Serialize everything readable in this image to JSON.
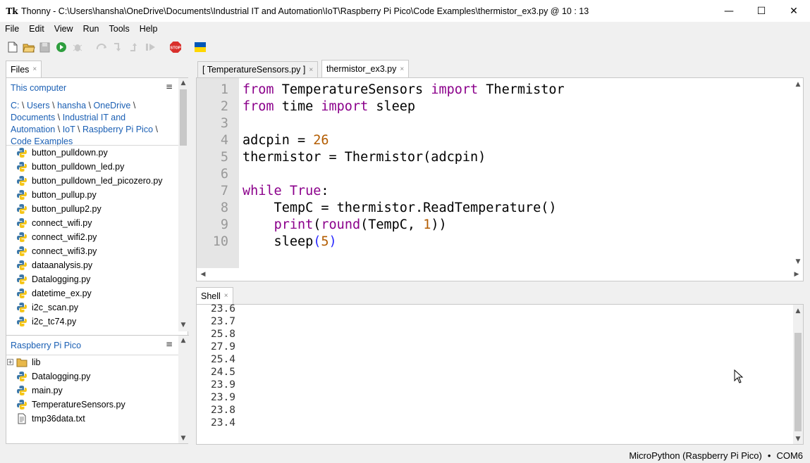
{
  "window": {
    "app_icon": "Tk",
    "title": "Thonny  -  C:\\Users\\hansha\\OneDrive\\Documents\\Industrial IT and Automation\\IoT\\Raspberry Pi Pico\\Code Examples\\thermistor_ex3.py  @  10 : 13",
    "minimize": "—",
    "maximize": "☐",
    "close": "✕"
  },
  "menu": [
    "File",
    "Edit",
    "View",
    "Run",
    "Tools",
    "Help"
  ],
  "toolbar": {
    "buttons": [
      "new-file",
      "open-file",
      "save-file",
      "run",
      "debug",
      "step-over",
      "step-into",
      "step-out",
      "resume",
      "stop",
      "ukraine-flag"
    ],
    "stop_label": "STOP",
    "colors": {
      "run": "#2e9e3e",
      "stop": "#d9302c",
      "flag_blue": "#0057b7",
      "flag_yellow": "#ffd700"
    }
  },
  "files_tab": {
    "label": "Files",
    "close": "×"
  },
  "computer": {
    "title": "This computer",
    "menu_icon": "≡",
    "breadcrumb": [
      "C:",
      "Users",
      "hansha",
      "OneDrive",
      "Documents",
      "Industrial IT and Automation",
      "IoT",
      "Raspberry Pi Pico",
      "Code Examples"
    ],
    "breadcrumb_sep": "\\",
    "files": [
      "button_pulldown.py",
      "button_pulldown_led.py",
      "button_pulldown_led_picozero.py",
      "button_pullup.py",
      "button_pullup2.py",
      "connect_wifi.py",
      "connect_wifi2.py",
      "connect_wifi3.py",
      "dataanalysis.py",
      "Datalogging.py",
      "datetime_ex.py",
      "i2c_scan.py",
      "i2c_tc74.py"
    ]
  },
  "pico": {
    "title": "Raspberry Pi Pico",
    "menu_icon": "≡",
    "items": [
      {
        "name": "lib",
        "type": "folder",
        "expander": "+"
      },
      {
        "name": "Datalogging.py",
        "type": "python"
      },
      {
        "name": "main.py",
        "type": "python"
      },
      {
        "name": "TemperatureSensors.py",
        "type": "python"
      },
      {
        "name": "tmp36data.txt",
        "type": "text"
      }
    ]
  },
  "editor": {
    "tabs": [
      {
        "label": "[ TemperatureSensors.py ]",
        "close": "×",
        "active": false
      },
      {
        "label": "thermistor_ex3.py",
        "close": "×",
        "active": true
      }
    ],
    "line_numbers": [
      "1",
      "2",
      "3",
      "4",
      "5",
      "6",
      "7",
      "8",
      "9",
      "10"
    ],
    "lines": [
      [
        {
          "t": "from",
          "c": "kw"
        },
        {
          "t": " TemperatureSensors ",
          "c": ""
        },
        {
          "t": "import",
          "c": "kw"
        },
        {
          "t": " Thermistor",
          "c": ""
        }
      ],
      [
        {
          "t": "from",
          "c": "kw"
        },
        {
          "t": " time ",
          "c": ""
        },
        {
          "t": "import",
          "c": "kw"
        },
        {
          "t": " sleep",
          "c": ""
        }
      ],
      [],
      [
        {
          "t": "adcpin = ",
          "c": ""
        },
        {
          "t": "26",
          "c": "num"
        }
      ],
      [
        {
          "t": "thermistor = Thermistor(adcpin)",
          "c": ""
        }
      ],
      [],
      [
        {
          "t": "while",
          "c": "kw"
        },
        {
          "t": " ",
          "c": ""
        },
        {
          "t": "True",
          "c": "kw"
        },
        {
          "t": ":",
          "c": ""
        }
      ],
      [
        {
          "t": "    TempC = thermistor.ReadTemperature()",
          "c": ""
        }
      ],
      [
        {
          "t": "    ",
          "c": ""
        },
        {
          "t": "print",
          "c": "bi"
        },
        {
          "t": "(",
          "c": ""
        },
        {
          "t": "round",
          "c": "bi"
        },
        {
          "t": "(TempC, ",
          "c": ""
        },
        {
          "t": "1",
          "c": "num"
        },
        {
          "t": "))",
          "c": ""
        }
      ],
      [
        {
          "t": "    sleep",
          "c": ""
        },
        {
          "t": "(",
          "c": "hl"
        },
        {
          "t": "5",
          "c": "num"
        },
        {
          "t": ")",
          "c": "hl"
        }
      ]
    ]
  },
  "shell": {
    "tab_label": "Shell",
    "close": "×",
    "output": [
      "23.6",
      "23.7",
      "25.8",
      "27.9",
      "25.4",
      "24.5",
      "23.9",
      "23.9",
      "23.8",
      "23.4"
    ]
  },
  "status": {
    "interpreter": "MicroPython (Raspberry Pi Pico)",
    "dot": "•",
    "port": "COM6"
  }
}
